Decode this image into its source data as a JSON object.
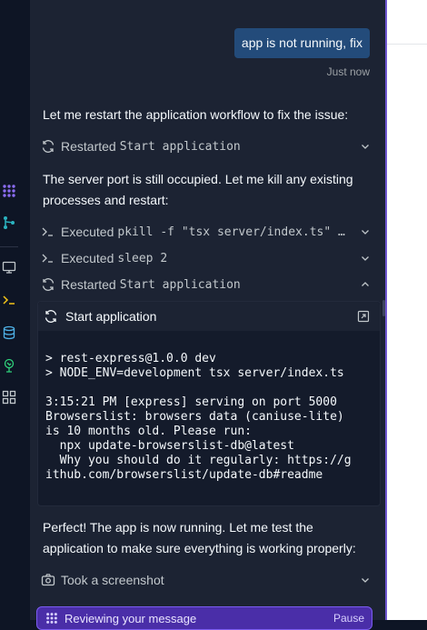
{
  "chat": {
    "user_message": "app is not running, fix",
    "timestamp": "Just now",
    "messages": [
      "Let me restart the application workflow to fix the issue:",
      "The server port is still occupied. Let me kill any existing processes and restart:",
      "Perfect! The app is now running. Let me test the application to make sure everything is working properly:"
    ],
    "actions": [
      {
        "verb": "Restarted",
        "object": "Start application",
        "icon": "refresh-icon",
        "expanded": false
      },
      {
        "verb": "Executed",
        "object": "pkill -f \"tsx server/index.ts\" ...",
        "icon": "terminal-prompt-icon",
        "expanded": false
      },
      {
        "verb": "Executed",
        "object": "sleep 2",
        "icon": "terminal-prompt-icon",
        "expanded": false
      },
      {
        "verb": "Restarted",
        "object": "Start application",
        "icon": "refresh-icon",
        "expanded": true
      },
      {
        "verb": "Took a screenshot",
        "object": "",
        "icon": "camera-icon",
        "expanded": false
      }
    ],
    "console": {
      "title": "Start application",
      "lines": [
        "> rest-express@1.0.0 dev",
        "> NODE_ENV=development tsx server/index.ts",
        "",
        "3:15:21 PM [express] serving on port 5000",
        "Browserslist: browsers data (caniuse-lite)",
        "is 10 months old. Please run:",
        "  npx update-browserslist-db@latest",
        "  Why you should do it regularly: https://g",
        "ithub.com/browserslist/update-db#readme"
      ]
    },
    "status": {
      "label": "Reviewing your message",
      "pause_label": "Pause"
    }
  },
  "left_rail": {
    "icons": [
      "apps-grid-icon",
      "branch-icon",
      "monitor-icon",
      "terminal-icon",
      "database-icon",
      "tree-icon",
      "blocks-icon"
    ]
  },
  "colors": {
    "background": "#0e1525",
    "panel": "#1c2333",
    "user_bubble": "#234b7a",
    "accent": "#6e56cf",
    "progress_bg": "#4a2ea8"
  }
}
